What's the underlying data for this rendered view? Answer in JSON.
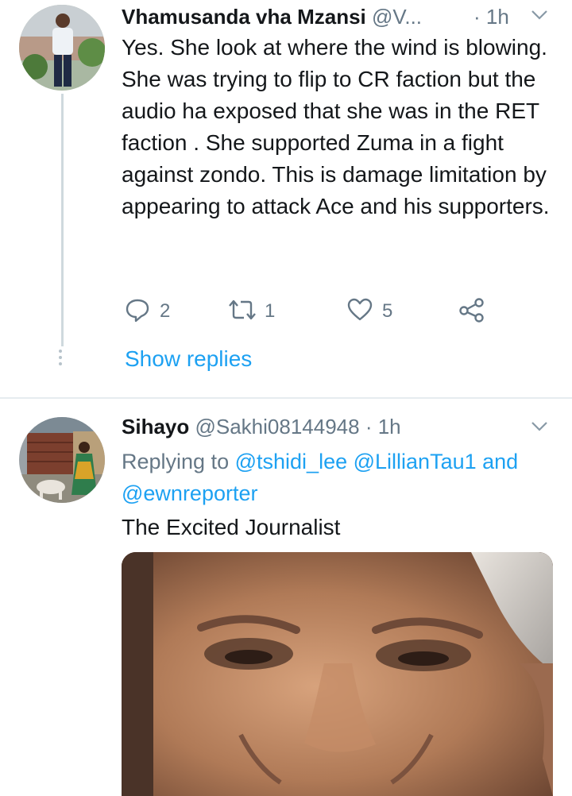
{
  "tweet1": {
    "display_name": "Vhamusanda vha Mzansi",
    "handle": "@V...",
    "time": "· 1h",
    "text": "Yes. She look at where the wind is blowing. She was trying to flip to CR faction but the audio ha exposed that she was in the RET faction . She supported Zuma in a fight against zondo. This is damage limitation by appearing to attack Ace and his supporters.",
    "reply_count": "2",
    "retweet_count": "1",
    "like_count": "5",
    "show_replies_label": "Show replies"
  },
  "tweet2": {
    "display_name": "Sihayo",
    "handle": "@Sakhi08144948",
    "time": "· 1h",
    "replying_prefix": "Replying to",
    "mention1": "@tshidi_lee",
    "mention2": "@LillianTau1",
    "and_word": "and",
    "mention3": "@ewnreporter",
    "text": "The Excited Journalist"
  },
  "colors": {
    "link": "#1da1f2",
    "secondary": "#657786",
    "primary_text": "#14171a",
    "divider": "#e6ecf0"
  },
  "icons": {
    "reply": "speech-bubble-icon",
    "retweet": "retweet-icon",
    "like": "heart-icon",
    "share": "share-icon",
    "menu": "chevron-down-icon"
  }
}
